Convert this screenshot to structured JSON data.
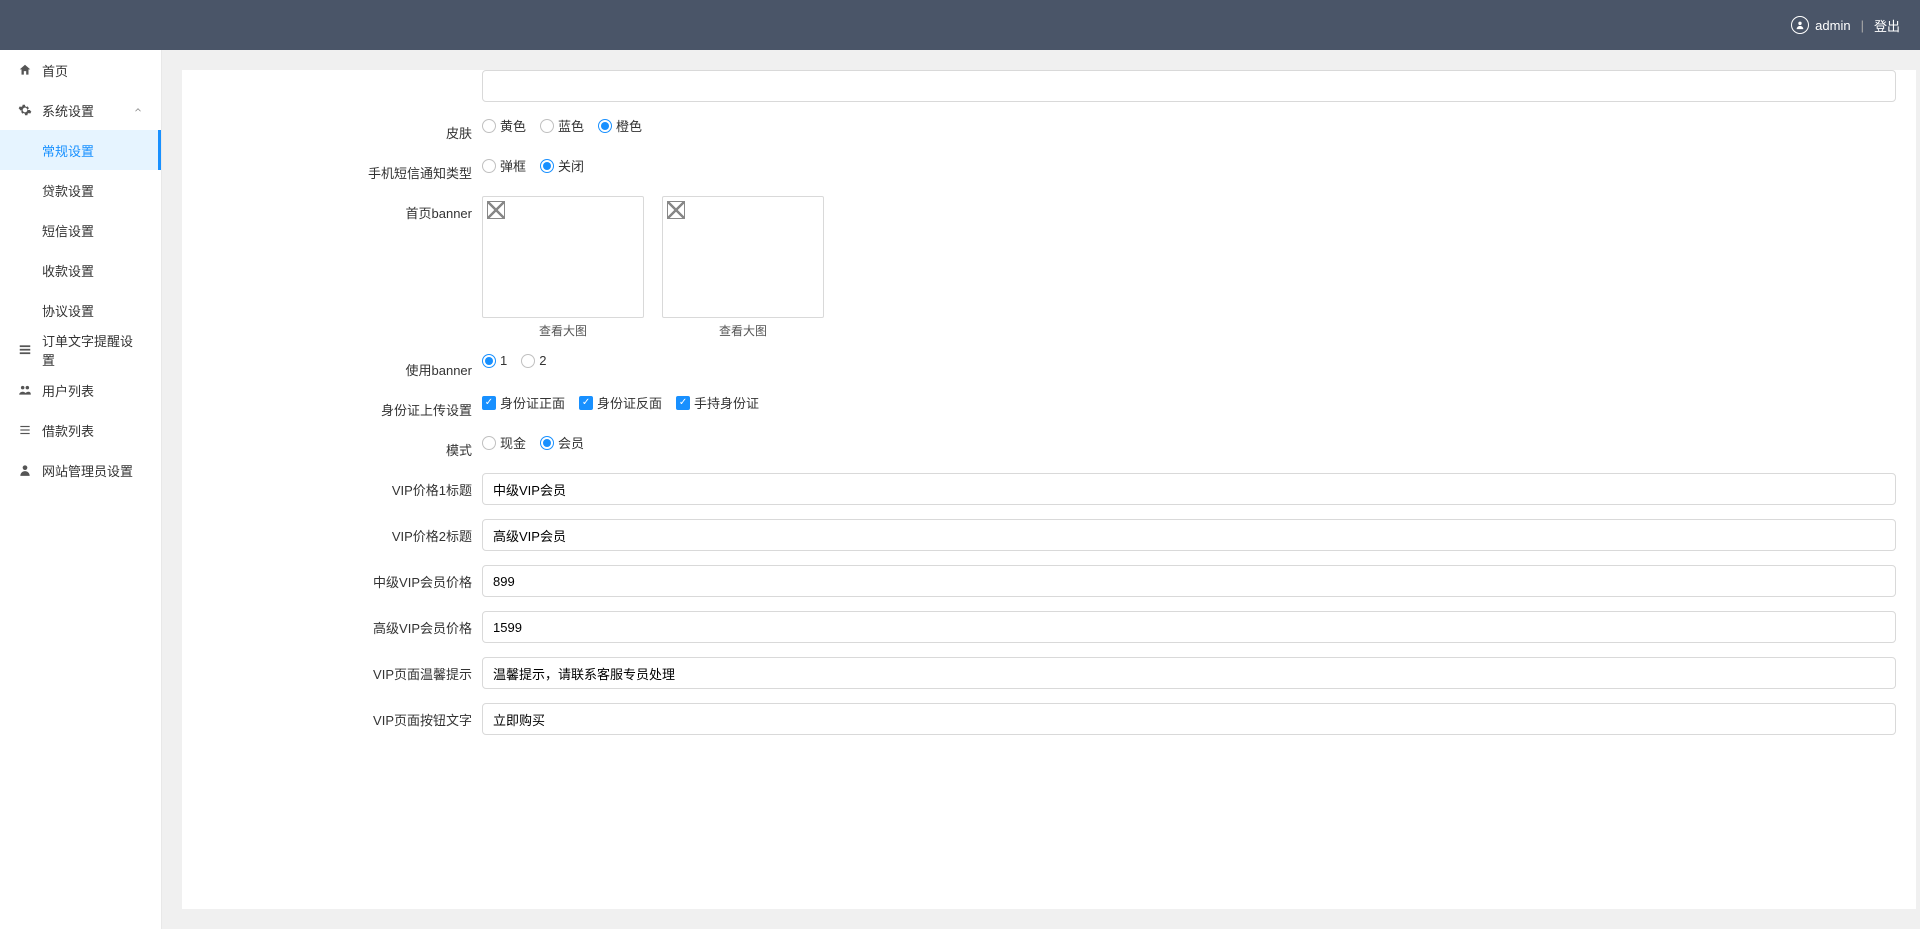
{
  "header": {
    "username": "admin",
    "logout": "登出",
    "divider": "|"
  },
  "sidebar": {
    "items": [
      {
        "label": "首页",
        "icon": "home"
      },
      {
        "label": "系统设置",
        "icon": "gear",
        "expanded": true,
        "children": [
          {
            "label": "常规设置",
            "active": true
          },
          {
            "label": "贷款设置"
          },
          {
            "label": "短信设置"
          },
          {
            "label": "收款设置"
          },
          {
            "label": "协议设置"
          }
        ]
      },
      {
        "label": "订单文字提醒设置",
        "icon": "list"
      },
      {
        "label": "用户列表",
        "icon": "users"
      },
      {
        "label": "借款列表",
        "icon": "lines"
      },
      {
        "label": "网站管理员设置",
        "icon": "person"
      }
    ]
  },
  "form": {
    "top_field": {
      "label": "",
      "value": ""
    },
    "skin": {
      "label": "皮肤",
      "options": [
        "黄色",
        "蓝色",
        "橙色"
      ],
      "selected": "橙色"
    },
    "sms_notify": {
      "label": "手机短信通知类型",
      "options": [
        "弹框",
        "关闭"
      ],
      "selected": "关闭"
    },
    "banner": {
      "label": "首页banner",
      "caption": "查看大图"
    },
    "use_banner": {
      "label": "使用banner",
      "options": [
        "1",
        "2"
      ],
      "selected": "1"
    },
    "id_upload": {
      "label": "身份证上传设置",
      "options": [
        "身份证正面",
        "身份证反面",
        "手持身份证"
      ],
      "checked": [
        "身份证正面",
        "身份证反面",
        "手持身份证"
      ]
    },
    "mode": {
      "label": "模式",
      "options": [
        "现金",
        "会员"
      ],
      "selected": "会员"
    },
    "vip_price1_title": {
      "label": "VIP价格1标题",
      "value": "中级VIP会员"
    },
    "vip_price2_title": {
      "label": "VIP价格2标题",
      "value": "高级VIP会员"
    },
    "mid_vip_price": {
      "label": "中级VIP会员价格",
      "value": "899"
    },
    "high_vip_price": {
      "label": "高级VIP会员价格",
      "value": "1599"
    },
    "vip_tip": {
      "label": "VIP页面温馨提示",
      "value": "温馨提示，请联系客服专员处理"
    },
    "vip_btn_text": {
      "label": "VIP页面按钮文字",
      "value": "立即购买"
    }
  }
}
